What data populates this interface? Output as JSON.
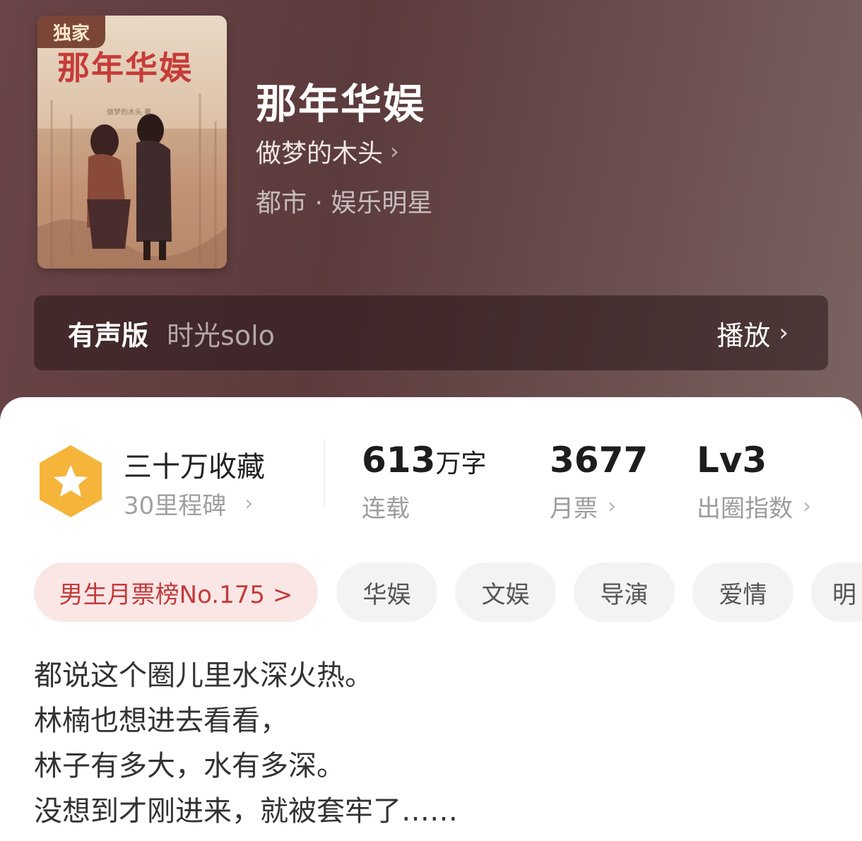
{
  "book": {
    "badge": "独家",
    "cover_title": "那年华娱",
    "cover_author_text": "做梦的木头 著",
    "title": "那年华娱",
    "author": "做梦的木头",
    "genre": "都市 · 娱乐明星"
  },
  "audio": {
    "label": "有声版",
    "narrator": "时光solo",
    "play_label": "播放"
  },
  "stats": {
    "milestone_title": "三十万收藏",
    "milestone_sub": "30里程碑",
    "word_count_value": "613",
    "word_count_unit": "万字",
    "word_count_label": "连载",
    "monthly_votes_value": "3677",
    "monthly_votes_label": "月票",
    "index_value": "Lv3",
    "index_label": "出圈指数"
  },
  "tags": [
    "男生月票榜No.175 >",
    "华娱",
    "文娱",
    "导演",
    "爱情",
    "明"
  ],
  "description": [
    "都说这个圈儿里水深火热。",
    "林楠也想进去看看，",
    "林子有多大，水有多深。",
    "没想到才刚进来，就被套牢了……"
  ],
  "colors": {
    "hero_bg": "#5c3b3d",
    "badge_bg": "#7b4638",
    "medal": "#f5b43a",
    "rank_tag_bg": "#fbe6e6",
    "rank_tag_text": "#c23b3b"
  },
  "icons": {
    "author_chevron": "chevron-right-icon",
    "play_chevron": "chevron-right-icon",
    "medal": "star-hexagon-icon"
  }
}
